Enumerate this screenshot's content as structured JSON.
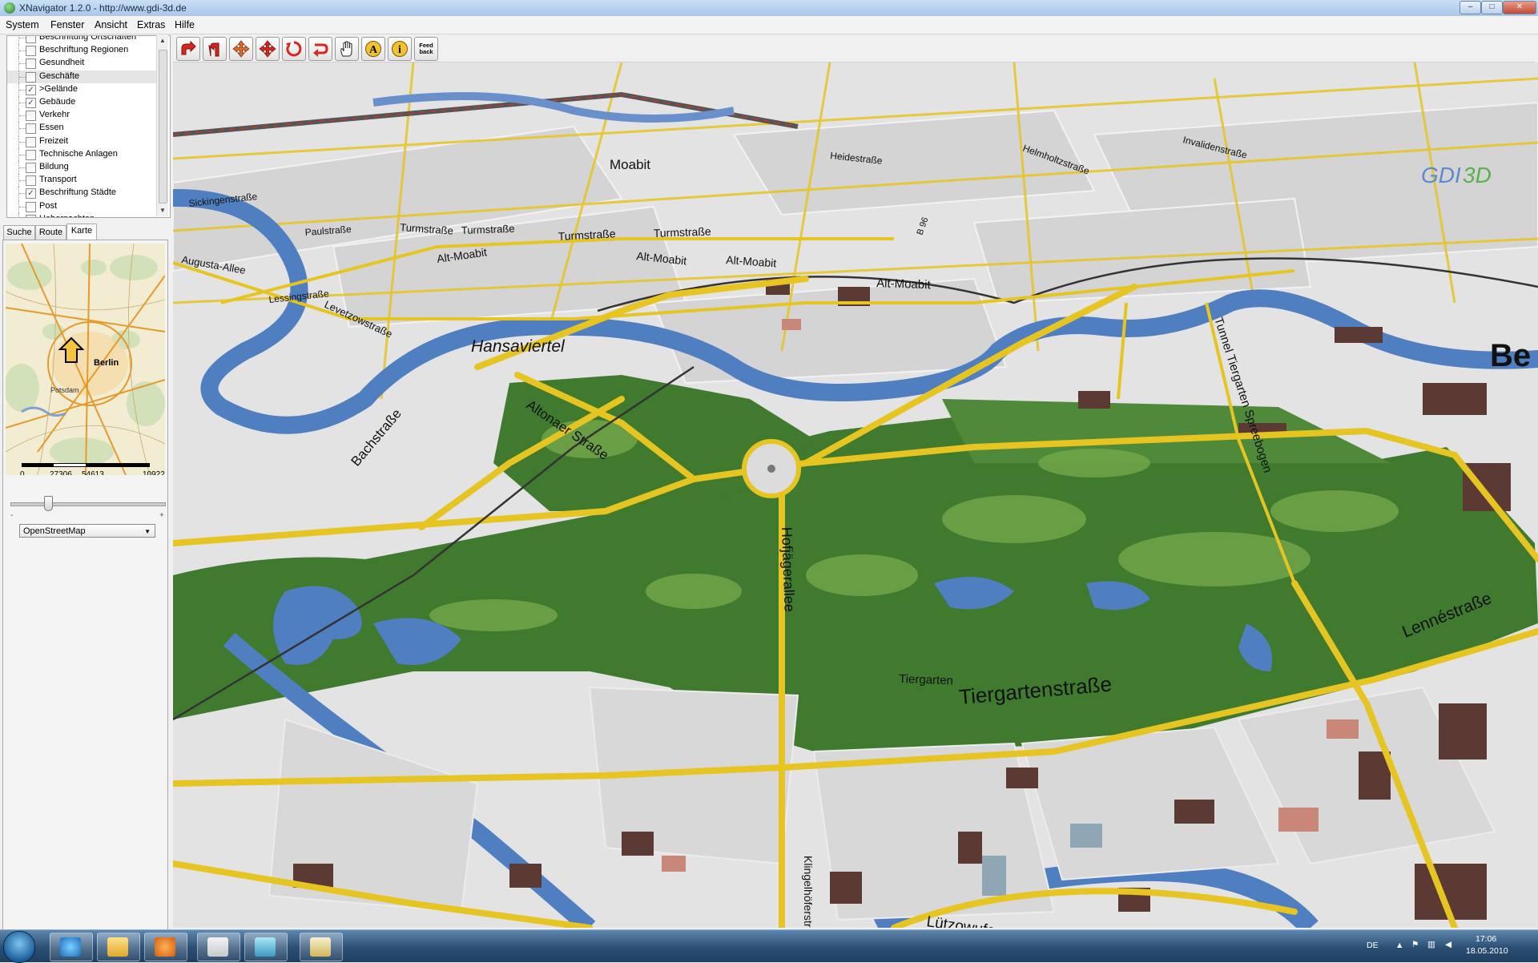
{
  "window": {
    "title": "XNavigator 1.2.0 - http://www.gdi-3d.de",
    "minimize": "–",
    "maximize": "□",
    "close": "✕"
  },
  "menu": [
    "System",
    "Fenster",
    "Ansicht",
    "Extras",
    "Hilfe"
  ],
  "layers": [
    {
      "label": "Beschriftung Ortschaften",
      "checked": false
    },
    {
      "label": "Beschriftung Regionen",
      "checked": false
    },
    {
      "label": "Gesundheit",
      "checked": false
    },
    {
      "label": "Geschäfte",
      "checked": false
    },
    {
      "label": ">Gelände",
      "checked": true
    },
    {
      "label": "Gebäude",
      "checked": true
    },
    {
      "label": "Verkehr",
      "checked": false
    },
    {
      "label": "Essen",
      "checked": false
    },
    {
      "label": "Freizeit",
      "checked": false
    },
    {
      "label": "Technische Anlagen",
      "checked": false
    },
    {
      "label": "Bildung",
      "checked": false
    },
    {
      "label": "Transport",
      "checked": false
    },
    {
      "label": "Beschriftung Städte",
      "checked": true
    },
    {
      "label": "Post",
      "checked": false
    },
    {
      "label": "Uebernachten",
      "checked": true
    }
  ],
  "check_mark": "✓",
  "tabs": [
    "Suche",
    "Route",
    "Karte"
  ],
  "active_tab": "Karte",
  "minimap": {
    "labels": [
      "Berlin",
      "Potsdam"
    ],
    "scale_labels": [
      "0",
      "27306",
      "54613",
      "10922"
    ]
  },
  "zoom_slider": {
    "min_label": "-",
    "max_label": "+",
    "level": 0.23
  },
  "map_source": {
    "selected": "OpenStreetMap"
  },
  "toolbar": {
    "icons": [
      "move-forward-icon",
      "turn-left-icon",
      "pan-icon",
      "move-icon",
      "rotate-icon",
      "rewind-icon",
      "hand-icon",
      "annotation-icon",
      "info-icon",
      "feedback-icon"
    ],
    "annotation_label": "A",
    "info_label": "i",
    "feedback_label_1": "Feed",
    "feedback_label_2": "back"
  },
  "map": {
    "logo_part1": "GDI",
    "logo_part2": "3D",
    "labels": [
      "Moabit",
      "Hansaviertel",
      "Turmstraße",
      "Turmstraße",
      "Turmstraße",
      "Turmstraße",
      "Alt-Moabit",
      "Alt-Moabit",
      "Alt-Moabit",
      "Alt-Moabit",
      "Bachstraße",
      "Altonaer Straße",
      "Hofjägerallee",
      "Tiergarten",
      "Tiergartenstraße",
      "Lennéstraße",
      "Tunnel Tiergarten Spreebogen",
      "Lützowufer",
      "Klingelhöferstraße",
      "Paulstraße",
      "Lessingstraße",
      "Sickingenstraße",
      "Helmholtzstraße",
      "Invalidenstraße",
      "Heidestraße",
      "Augusta-Allee",
      "Levetzowstraße",
      "B 96",
      "Be"
    ]
  },
  "taskbar": {
    "language": "DE",
    "time": "17:06",
    "date": "18.05.2010"
  },
  "colors": {
    "park": "#3f7a2f",
    "park_light": "#74a84a",
    "water": "#4f7fc0",
    "street": "#e6c421",
    "land": "#e4e4e4"
  }
}
